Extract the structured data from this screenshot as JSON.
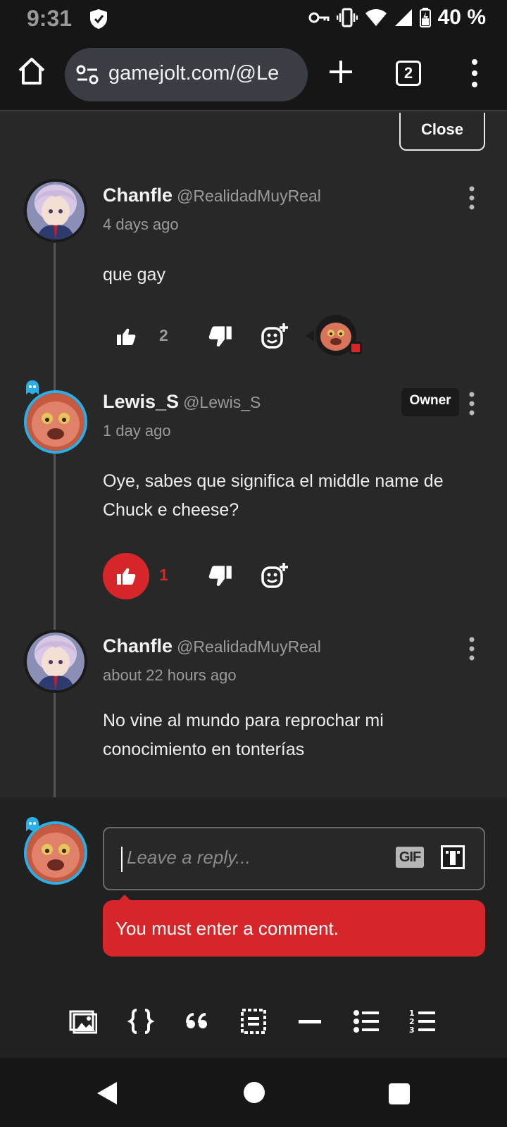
{
  "status_bar": {
    "time": "9:31",
    "battery_text": "40 %",
    "icons": [
      "vpn-shield-icon",
      "key-icon",
      "vibrate-icon",
      "wifi-icon",
      "signal-icon",
      "battery-icon"
    ]
  },
  "browser": {
    "url": "gamejolt.com/@Le",
    "tab_count": "2",
    "icons": [
      "home-icon",
      "site-settings-icon",
      "new-tab-icon",
      "tab-switcher-icon",
      "menu-icon"
    ]
  },
  "close_label": "Close",
  "comments": [
    {
      "name": "Chanfle",
      "handle": "@RealidadMuyReal",
      "time": "4 days ago",
      "body": "que gay",
      "likes": "2",
      "liked": false
    },
    {
      "name": "Lewis_S",
      "handle": "@Lewis_S",
      "badge": "Owner",
      "time": "1 day ago",
      "body": "Oye, sabes que significa el middle name de Chuck e cheese?",
      "likes": "1",
      "liked": true
    },
    {
      "name": "Chanfle",
      "handle": "@RealidadMuyReal",
      "time": "about 22 hours ago",
      "body": "No vine al mundo para reprochar mi conocimiento en tonterías"
    }
  ],
  "reply": {
    "placeholder": "Leave a reply...",
    "gif_label": "GIF",
    "error": "You must enter a comment."
  },
  "colors": {
    "background": "#282828",
    "accent_red": "#d7262a",
    "avatar_ring_blue": "#2ab0e6"
  }
}
